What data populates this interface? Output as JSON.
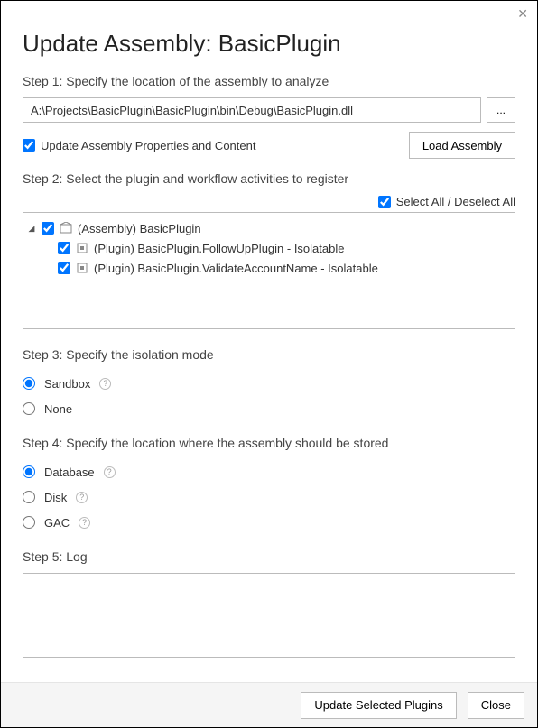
{
  "title": "Update Assembly: BasicPlugin",
  "step1": {
    "label": "Step 1: Specify the location of the assembly to analyze",
    "path": "A:\\Projects\\BasicPlugin\\BasicPlugin\\bin\\Debug\\BasicPlugin.dll",
    "browse": "...",
    "updateCheckbox": "Update Assembly Properties and Content",
    "loadBtn": "Load Assembly"
  },
  "step2": {
    "label": "Step 2: Select the plugin and workflow activities to register",
    "selectAll": "Select All / Deselect All",
    "assembly": "(Assembly) BasicPlugin",
    "plugins": [
      "(Plugin) BasicPlugin.FollowUpPlugin - Isolatable",
      "(Plugin) BasicPlugin.ValidateAccountName - Isolatable"
    ]
  },
  "step3": {
    "label": "Step 3: Specify the isolation mode",
    "options": {
      "sandbox": "Sandbox",
      "none": "None"
    }
  },
  "step4": {
    "label": "Step 4: Specify the location where the assembly should be stored",
    "options": {
      "database": "Database",
      "disk": "Disk",
      "gac": "GAC"
    }
  },
  "step5": {
    "label": "Step 5: Log"
  },
  "footer": {
    "update": "Update Selected Plugins",
    "close": "Close"
  }
}
